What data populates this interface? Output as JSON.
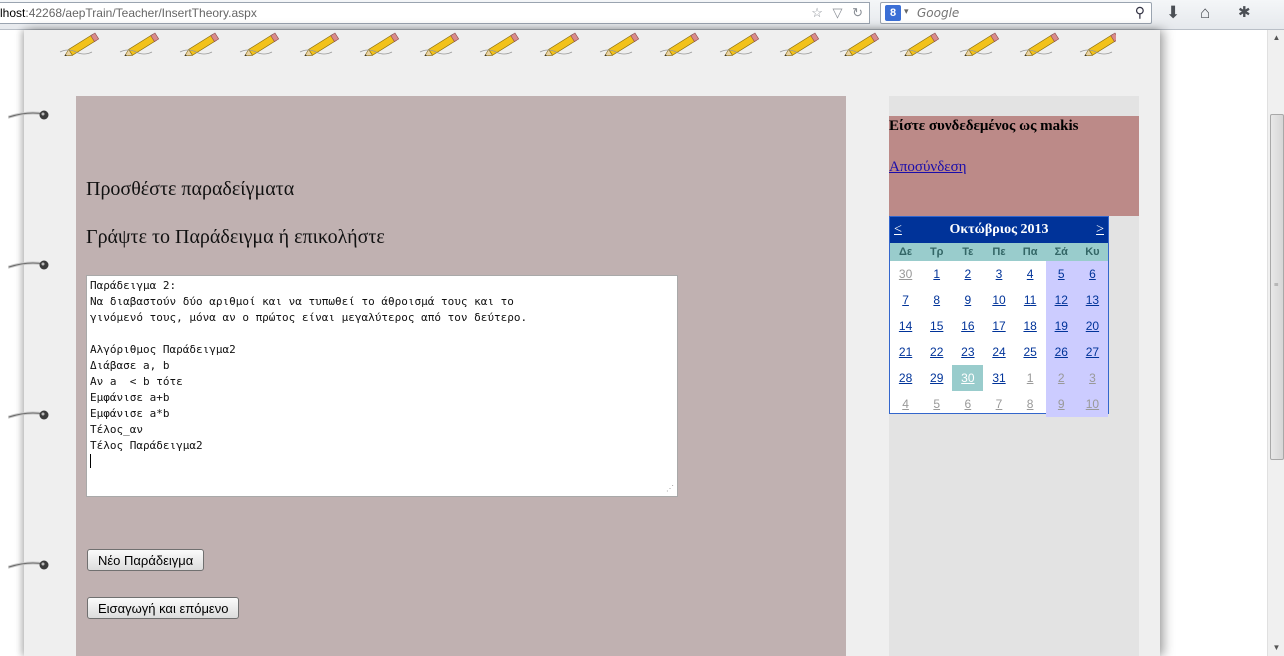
{
  "browser": {
    "url_host": "lhost",
    "url_rest": ":42268/aepTrain/Teacher/InsertTheory.aspx",
    "search_placeholder": "Google",
    "search_engine_letter": "8",
    "icons": [
      "star-icon",
      "dropdown-arrow-icon",
      "refresh-icon",
      "search-icon",
      "download-icon",
      "home-icon",
      "bug-icon"
    ]
  },
  "main": {
    "heading_add": "Προσθέστε παραδείγματα",
    "heading_write": "Γράψτε το Παράδειγμα ή επικολήστε",
    "example_text": "Παράδειγμα 2:\nΝα διαβαστούν δύο αριθμοί και να τυπωθεί το άθροισμά τους και το\nγινόμενό τους, μόνα αν ο πρώτος είναι μεγαλύτερος από τον δεύτερο.\n\nΑλγόριθμος Παράδειγμα2\nΔιάβασε a, b\nΑν a  < b τότε\nΕμφάνισε a+b\nΕμφάνισε a*b\nΤέλος_αν\nΤέλος Παράδειγμα2\n",
    "new_example_button": "Νέο Παράδειγμα",
    "insert_next_button": "Εισαγωγή και επόμενο"
  },
  "sidebar": {
    "login_text": "Είστε συνδεδεμένος ως makis",
    "logout_link": "Αποσύνδεση"
  },
  "calendar": {
    "title": "Οκτώβριος 2013",
    "prev": "<",
    "next": ">",
    "day_headers": [
      "Δε",
      "Τρ",
      "Τε",
      "Πε",
      "Πα",
      "Σά",
      "Κυ"
    ],
    "weeks": [
      [
        {
          "d": "30",
          "m": "other"
        },
        {
          "d": "1",
          "m": "cur"
        },
        {
          "d": "2",
          "m": "cur"
        },
        {
          "d": "3",
          "m": "cur"
        },
        {
          "d": "4",
          "m": "cur"
        },
        {
          "d": "5",
          "m": "cur"
        },
        {
          "d": "6",
          "m": "cur"
        }
      ],
      [
        {
          "d": "7",
          "m": "cur"
        },
        {
          "d": "8",
          "m": "cur"
        },
        {
          "d": "9",
          "m": "cur"
        },
        {
          "d": "10",
          "m": "cur"
        },
        {
          "d": "11",
          "m": "cur"
        },
        {
          "d": "12",
          "m": "cur"
        },
        {
          "d": "13",
          "m": "cur"
        }
      ],
      [
        {
          "d": "14",
          "m": "cur"
        },
        {
          "d": "15",
          "m": "cur"
        },
        {
          "d": "16",
          "m": "cur"
        },
        {
          "d": "17",
          "m": "cur"
        },
        {
          "d": "18",
          "m": "cur"
        },
        {
          "d": "19",
          "m": "cur"
        },
        {
          "d": "20",
          "m": "cur"
        }
      ],
      [
        {
          "d": "21",
          "m": "cur"
        },
        {
          "d": "22",
          "m": "cur"
        },
        {
          "d": "23",
          "m": "cur"
        },
        {
          "d": "24",
          "m": "cur"
        },
        {
          "d": "25",
          "m": "cur"
        },
        {
          "d": "26",
          "m": "cur"
        },
        {
          "d": "27",
          "m": "cur"
        }
      ],
      [
        {
          "d": "28",
          "m": "cur"
        },
        {
          "d": "29",
          "m": "cur"
        },
        {
          "d": "30",
          "m": "today"
        },
        {
          "d": "31",
          "m": "cur"
        },
        {
          "d": "1",
          "m": "other"
        },
        {
          "d": "2",
          "m": "other"
        },
        {
          "d": "3",
          "m": "other"
        }
      ],
      [
        {
          "d": "4",
          "m": "other"
        },
        {
          "d": "5",
          "m": "other"
        },
        {
          "d": "6",
          "m": "other"
        },
        {
          "d": "7",
          "m": "other"
        },
        {
          "d": "8",
          "m": "other"
        },
        {
          "d": "9",
          "m": "other"
        },
        {
          "d": "10",
          "m": "other"
        }
      ]
    ]
  },
  "colors": {
    "main_panel": "#c0b1b1",
    "login_panel": "#bc8a88",
    "calendar_header": "#003399",
    "calendar_day_header": "#99cccc",
    "weekend": "#ccccff",
    "today": "#99cccc"
  }
}
